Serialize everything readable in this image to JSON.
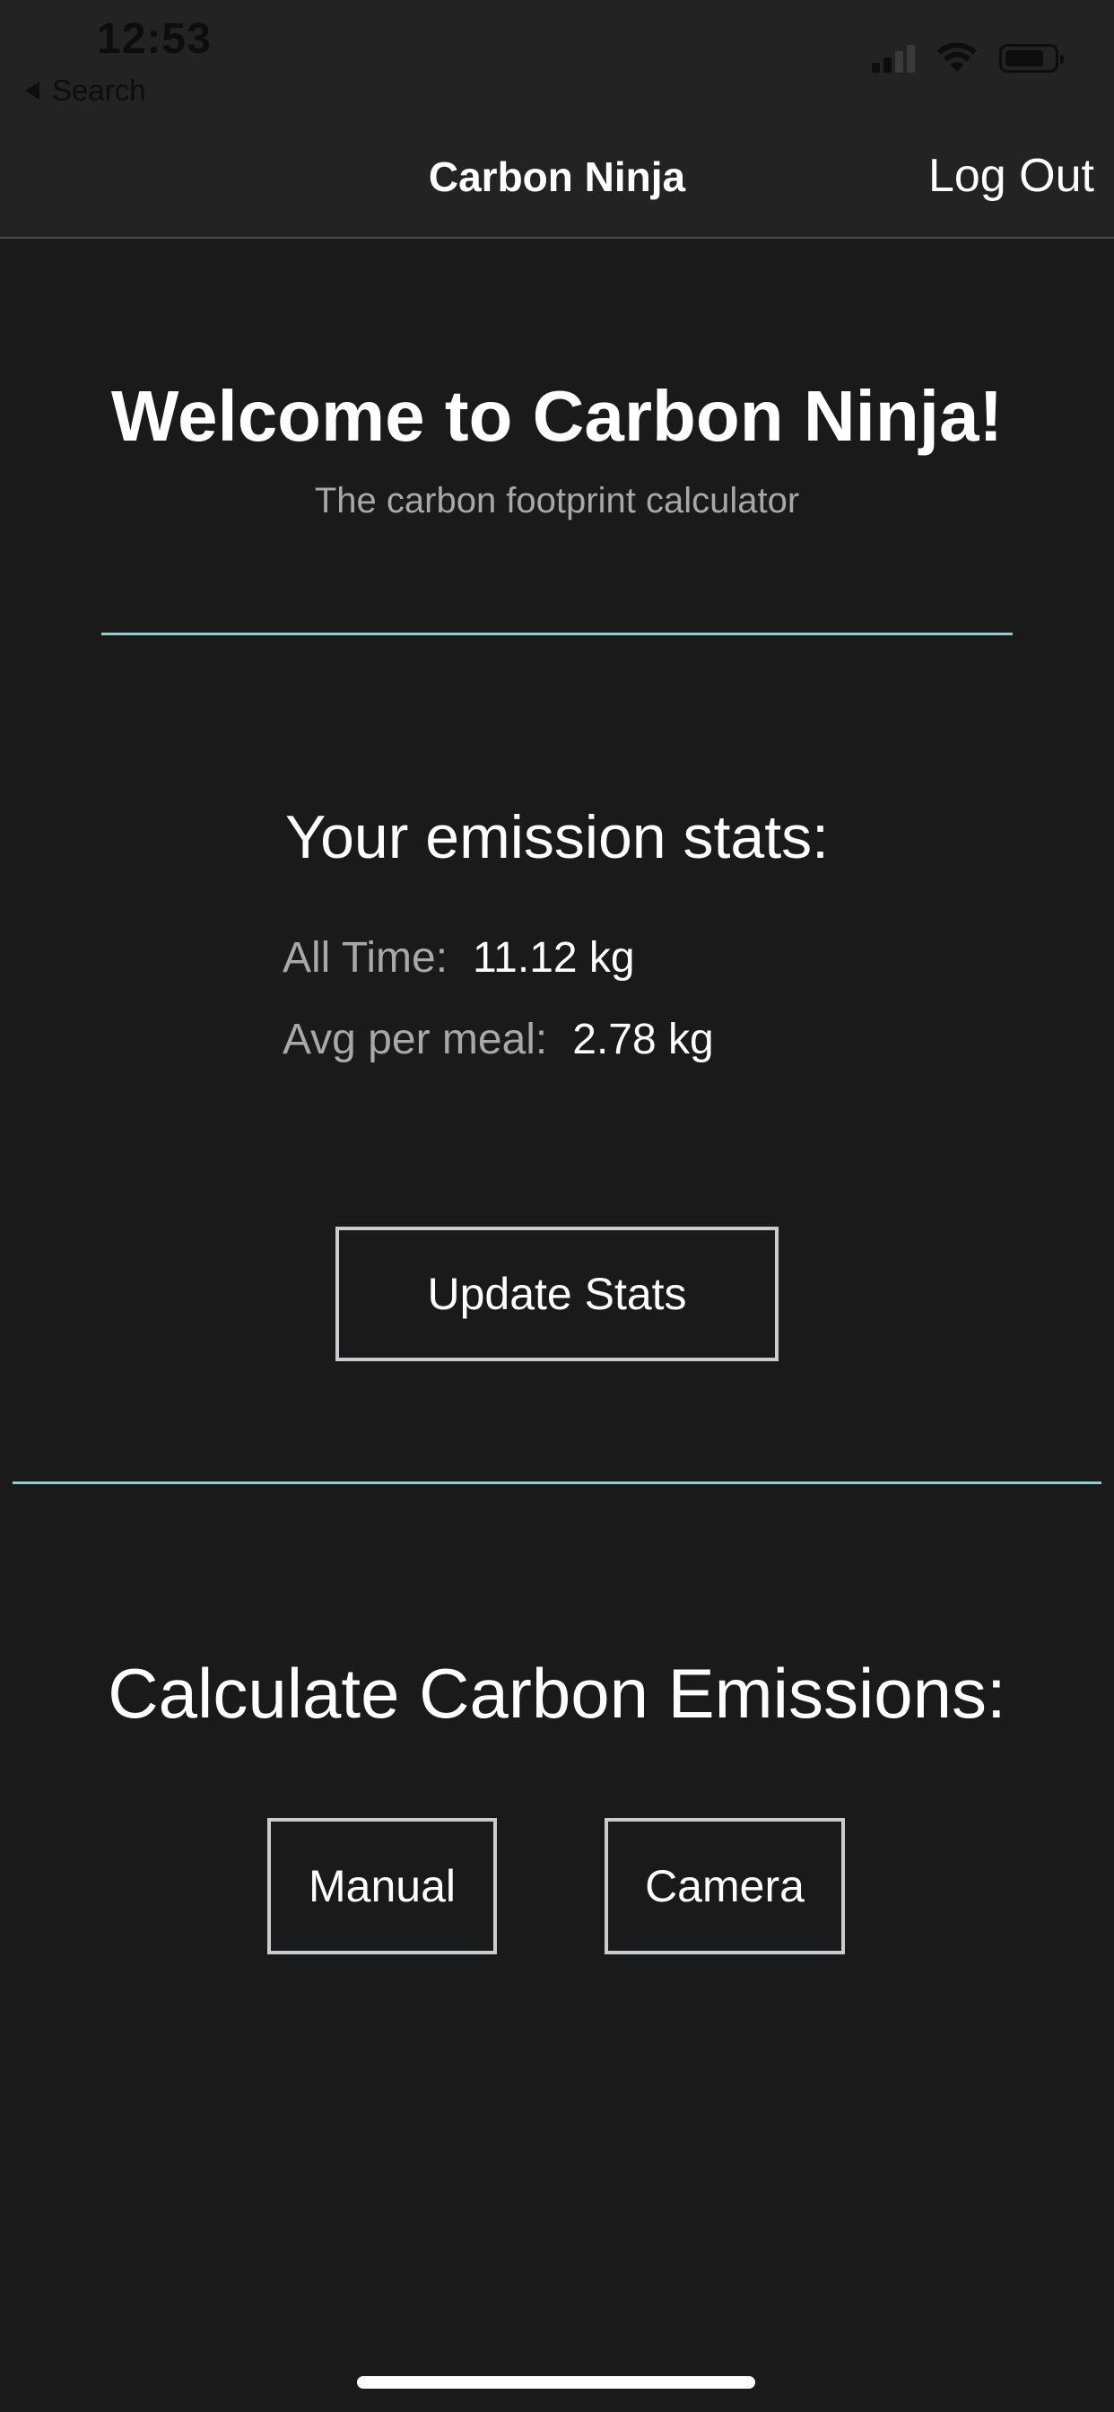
{
  "status_bar": {
    "time": "12:53",
    "back_label": "Search",
    "icons": [
      "signal-icon",
      "wifi-icon",
      "battery-icon"
    ]
  },
  "nav": {
    "title": "Carbon Ninja",
    "logout_label": "Log Out"
  },
  "hero": {
    "title": "Welcome to Carbon Ninja!",
    "subtitle": "The carbon footprint calculator"
  },
  "stats": {
    "title": "Your emission stats:",
    "rows": [
      {
        "label": "All Time:",
        "value": "11.12 kg"
      },
      {
        "label": "Avg per meal:",
        "value": "2.78 kg"
      }
    ],
    "update_label": "Update Stats"
  },
  "calculate": {
    "title": "Calculate Carbon Emissions:",
    "manual_label": "Manual",
    "camera_label": "Camera"
  },
  "colors": {
    "background": "#1a1a1a",
    "header": "#232323",
    "accent_divider": "#7fd6d2",
    "button_border": "#c8cdd2",
    "muted_text": "#a8a8a8"
  }
}
